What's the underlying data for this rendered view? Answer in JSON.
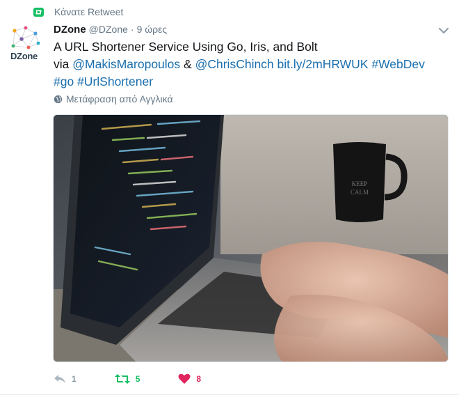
{
  "context": {
    "label": "Κάνατε Retweet",
    "icon": "retweet-icon",
    "color": "#17bf63"
  },
  "author": {
    "name": "DZone",
    "handle": "@DZone",
    "separator": "·",
    "time": "9 ώρες",
    "avatar_text": "DZone"
  },
  "tweet": {
    "line1": "A URL Shortener Service Using Go, Iris, and Bolt",
    "via": "via",
    "mention1": "@MakisMaropoulos",
    "amp": "&",
    "mention2": "@ChrisChinch",
    "link": "bit.ly/2mHRWUK",
    "hashtag1": "#WebDev",
    "hashtag2": "#go",
    "hashtag3": "#UrlShortener"
  },
  "translate": {
    "label": "Μετάφραση από Αγγλικά",
    "icon": "globe-icon"
  },
  "media": {
    "alt": "laptop-keyboard-coffee-mug-photo"
  },
  "actions": {
    "reply": {
      "count": "1",
      "icon": "reply-icon",
      "color": "#8899a6"
    },
    "retweet": {
      "count": "5",
      "icon": "retweet-icon",
      "color": "#17bf63",
      "active": true
    },
    "like": {
      "count": "8",
      "icon": "heart-icon",
      "color": "#e0245e",
      "active": true
    }
  },
  "colors": {
    "link": "#1a6fae",
    "muted": "#657786",
    "text": "#14171a"
  }
}
